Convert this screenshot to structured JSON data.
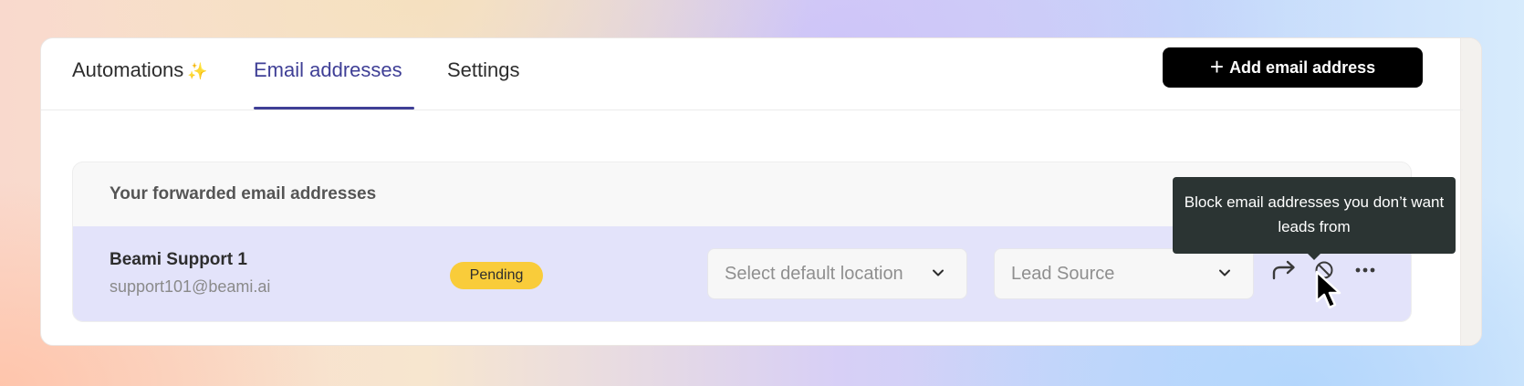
{
  "tabs": [
    {
      "label": "Automations",
      "icon": "sparkles-icon",
      "icon_glyph": "✨",
      "active": false
    },
    {
      "label": "Email addresses",
      "active": true
    },
    {
      "label": "Settings",
      "active": false
    }
  ],
  "toolbar": {
    "add_button_icon": "+",
    "add_button_label": "Add email address"
  },
  "panel": {
    "header": "Your forwarded email addresses",
    "rows": [
      {
        "name": "Beami Support 1",
        "email": "support101@beami.ai",
        "status": "Pending",
        "location_placeholder": "Select default location",
        "lead_source_placeholder": "Lead Source",
        "actions": [
          "forward-icon",
          "block-icon",
          "more-icon"
        ]
      }
    ]
  },
  "tooltip": {
    "text": "Block email addresses you don’t want leads from"
  },
  "colors": {
    "accent": "#3f3f96",
    "badge": "#f9cc3a",
    "row_highlight": "#e3e3fa",
    "tooltip_bg": "#2b3433",
    "button_bg": "#000000"
  }
}
